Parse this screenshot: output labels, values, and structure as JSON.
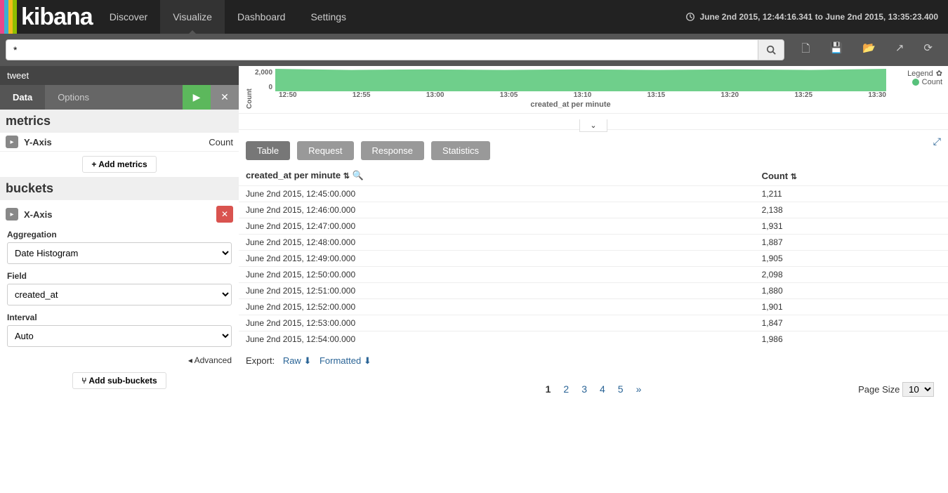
{
  "nav": {
    "brand": "kibana",
    "links": [
      "Discover",
      "Visualize",
      "Dashboard",
      "Settings"
    ],
    "active": 1,
    "time_range": "June 2nd 2015, 12:44:16.341 to June 2nd 2015, 13:35:23.400"
  },
  "query": {
    "value": "*"
  },
  "index_title": "tweet",
  "config_tabs": {
    "items": [
      "Data",
      "Options"
    ],
    "active": 0
  },
  "metrics": {
    "header": "metrics",
    "yaxis_label": "Y-Axis",
    "yaxis_value": "Count",
    "add_label": "Add metrics"
  },
  "buckets": {
    "header": "buckets",
    "xaxis_label": "X-Axis",
    "fields": {
      "agg_label": "Aggregation",
      "agg_value": "Date Histogram",
      "field_label": "Field",
      "field_value": "created_at",
      "interval_label": "Interval",
      "interval_value": "Auto"
    },
    "advanced": "Advanced",
    "add_sub": "Add sub-buckets"
  },
  "mini_chart": {
    "y_label": "Count",
    "y_ticks": [
      "2,000",
      "0"
    ],
    "x_ticks": [
      "12:50",
      "12:55",
      "13:00",
      "13:05",
      "13:10",
      "13:15",
      "13:20",
      "13:25",
      "13:30"
    ],
    "x_title": "created_at per minute",
    "legend_title": "Legend",
    "legend_item": "Count"
  },
  "result_tabs": {
    "items": [
      "Table",
      "Request",
      "Response",
      "Statistics"
    ],
    "active": 0
  },
  "table": {
    "col1": "created_at per minute",
    "col2": "Count",
    "rows": [
      {
        "t": "June 2nd 2015, 12:45:00.000",
        "c": "1,211"
      },
      {
        "t": "June 2nd 2015, 12:46:00.000",
        "c": "2,138"
      },
      {
        "t": "June 2nd 2015, 12:47:00.000",
        "c": "1,931"
      },
      {
        "t": "June 2nd 2015, 12:48:00.000",
        "c": "1,887"
      },
      {
        "t": "June 2nd 2015, 12:49:00.000",
        "c": "1,905"
      },
      {
        "t": "June 2nd 2015, 12:50:00.000",
        "c": "2,098"
      },
      {
        "t": "June 2nd 2015, 12:51:00.000",
        "c": "1,880"
      },
      {
        "t": "June 2nd 2015, 12:52:00.000",
        "c": "1,901"
      },
      {
        "t": "June 2nd 2015, 12:53:00.000",
        "c": "1,847"
      },
      {
        "t": "June 2nd 2015, 12:54:00.000",
        "c": "1,986"
      }
    ]
  },
  "export": {
    "label": "Export:",
    "raw": "Raw",
    "formatted": "Formatted"
  },
  "pager": {
    "pages": [
      "1",
      "2",
      "3",
      "4",
      "5",
      "»"
    ],
    "active": 0
  },
  "page_size": {
    "label": "Page Size",
    "value": "10"
  },
  "chart_data": {
    "type": "area",
    "title": "created_at per minute",
    "xlabel": "created_at per minute",
    "ylabel": "Count",
    "ylim": [
      0,
      2000
    ],
    "categories": [
      "12:50",
      "12:55",
      "13:00",
      "13:05",
      "13:10",
      "13:15",
      "13:20",
      "13:25",
      "13:30"
    ],
    "series": [
      {
        "name": "Count",
        "values": [
          2000,
          1900,
          1950,
          1900,
          1950,
          1900,
          1950,
          1900,
          2000
        ]
      }
    ]
  }
}
